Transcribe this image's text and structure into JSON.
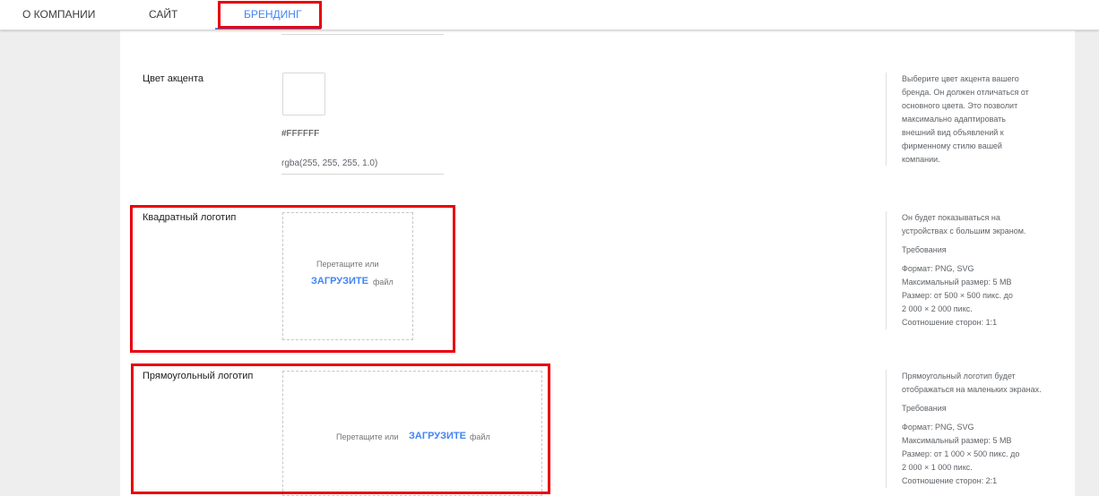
{
  "tabs": [
    {
      "label": "О КОМПАНИИ"
    },
    {
      "label": "САЙТ"
    },
    {
      "label": "БРЕНДИНГ"
    }
  ],
  "accent": {
    "label": "Цвет акцента",
    "swatch_color": "#FFFFFF",
    "hex": "#FFFFFF",
    "rgba": "rgba(255, 255, 255, 1.0)",
    "help": [
      "Выберите цвет акцента вашего",
      "бренда. Он должен отличаться от",
      "основного цвета. Это позволит",
      "максимально адаптировать",
      "внешний вид объявлений к",
      "фирменному стилю вашей",
      "компании."
    ]
  },
  "square_logo": {
    "label": "Квадратный логотип",
    "drop_text": "Перетащите или",
    "upload_label": "ЗАГРУЗИТЕ",
    "file_text": "файл",
    "help_intro": [
      "Он будет показываться на",
      "устройствах с большим экраном."
    ],
    "requirements_title": "Требования",
    "requirements": [
      "Формат: PNG, SVG",
      "Максимальный размер: 5 MB",
      "Размер: от 500 × 500 пикс. до",
      "2 000 × 2 000 пикс.",
      "Соотношение сторон: 1:1"
    ]
  },
  "rect_logo": {
    "label": "Прямоугольный логотип",
    "drop_text": "Перетащите или",
    "upload_label": "ЗАГРУЗИТЕ",
    "file_text": "файл",
    "help_intro": [
      "Прямоугольный логотип будет",
      "отображаться на маленьких экранах."
    ],
    "requirements_title": "Требования",
    "requirements": [
      "Формат: PNG, SVG",
      "Максимальный размер: 5 MB",
      "Размер: от 1 000 × 500 пикс. до",
      "2 000 × 1 000 пикс.",
      "Соотношение сторон: 2:1"
    ]
  },
  "colors": {
    "accent": "#4285f4",
    "highlight": "#e8000b"
  }
}
